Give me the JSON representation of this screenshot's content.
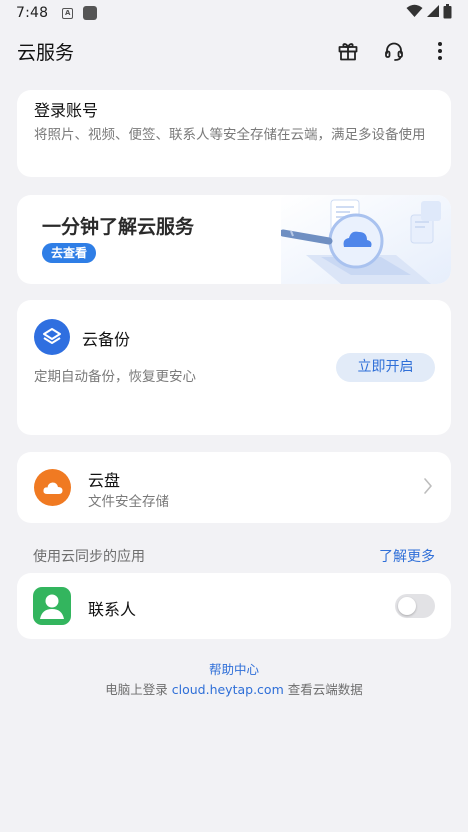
{
  "status_bar": {
    "time": "7:48",
    "icons": [
      "a-app-icon",
      "app-square-icon",
      "wifi-icon",
      "cellular-signal-icon",
      "battery-icon"
    ]
  },
  "app_bar": {
    "title": "云服务",
    "actions": [
      "gift-icon",
      "headset-icon",
      "more-vertical-icon"
    ]
  },
  "login": {
    "title": "登录账号",
    "description": "将照片、视频、便签、联系人等安全存储在云端，满足多设备使用"
  },
  "banner": {
    "title": "一分钟了解云服务",
    "button_label": "去查看"
  },
  "backup": {
    "title": "云备份",
    "description": "定期自动备份，恢复更安心",
    "button_label": "立即开启",
    "icon": "layers-icon"
  },
  "drive": {
    "title": "云盘",
    "description": "文件安全存储",
    "icon": "cloud-icon"
  },
  "sync_section": {
    "title": "使用云同步的应用",
    "link_label": "了解更多"
  },
  "contacts": {
    "title": "联系人",
    "enabled": false,
    "icon": "person-icon"
  },
  "footer": {
    "help_label": "帮助中心",
    "login_prefix": "电脑上登录 ",
    "login_url": "cloud.heytap.com",
    "login_suffix": " 查看云端数据"
  },
  "colors": {
    "accent": "#2f6fd8",
    "backup_icon_bg": "#2f6fe0",
    "drive_icon_bg": "#f07a22",
    "contacts_icon_bg": "#33b55e",
    "page_bg": "#f2f2f5"
  }
}
